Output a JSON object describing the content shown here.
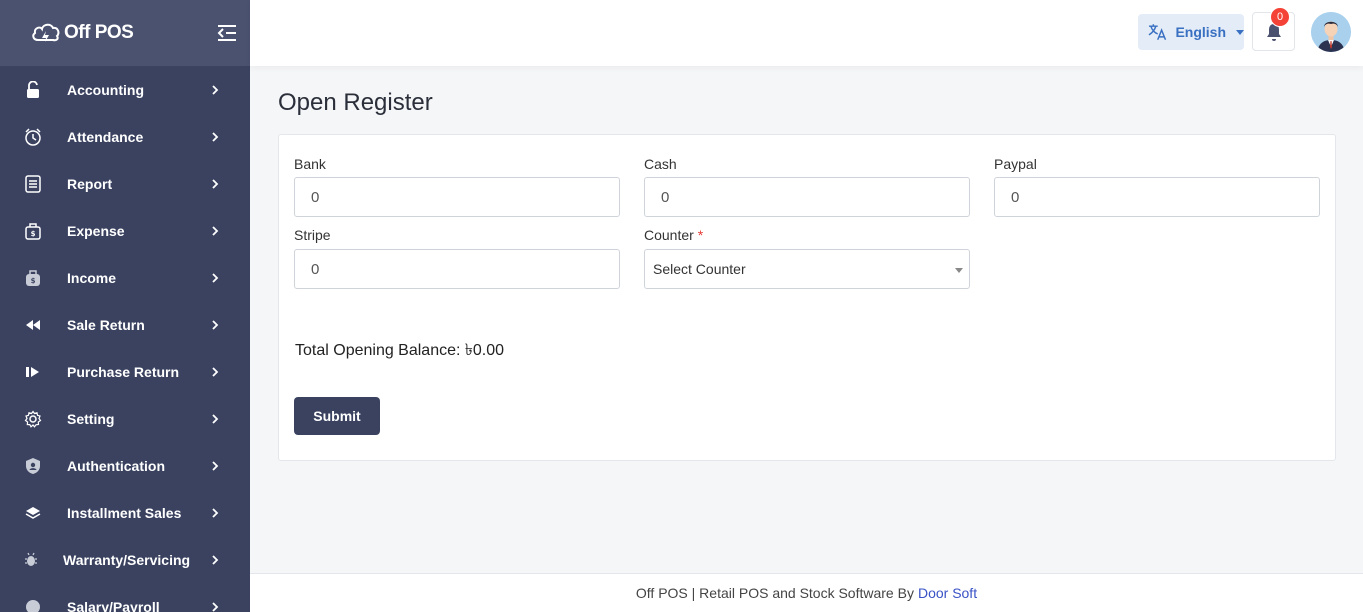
{
  "brand": {
    "name": "Off POS"
  },
  "sidebar": {
    "items": [
      {
        "label": "Accounting",
        "icon": "lock-icon"
      },
      {
        "label": "Attendance",
        "icon": "clock-icon"
      },
      {
        "label": "Report",
        "icon": "report-icon"
      },
      {
        "label": "Expense",
        "icon": "wallet-icon"
      },
      {
        "label": "Income",
        "icon": "money-bag-icon"
      },
      {
        "label": "Sale Return",
        "icon": "rewind-icon"
      },
      {
        "label": "Purchase Return",
        "icon": "forward-icon"
      },
      {
        "label": "Setting",
        "icon": "gear-icon"
      },
      {
        "label": "Authentication",
        "icon": "shield-user-icon"
      },
      {
        "label": "Installment Sales",
        "icon": "layers-icon"
      },
      {
        "label": "Warranty/Servicing",
        "icon": "bug-icon"
      },
      {
        "label": "Salary/Payroll",
        "icon": "coin-icon"
      }
    ]
  },
  "topbar": {
    "language": "English",
    "notification_count": "0"
  },
  "page": {
    "title": "Open Register"
  },
  "form": {
    "bank": {
      "label": "Bank",
      "value": "0"
    },
    "cash": {
      "label": "Cash",
      "value": "0"
    },
    "paypal": {
      "label": "Paypal",
      "value": "0"
    },
    "stripe": {
      "label": "Stripe",
      "value": "0"
    },
    "counter": {
      "label": "Counter",
      "required_mark": "*",
      "selected": "Select Counter"
    },
    "total_label": "Total Opening Balance:",
    "total_value": "৳0.00",
    "submit_label": "Submit"
  },
  "footer": {
    "text": "Off POS | Retail POS and Stock Software By",
    "link": "Door Soft"
  },
  "colors": {
    "sidebar_bg": "#3a4260",
    "accent_blue": "#3a70c2",
    "badge_red": "#f44336"
  }
}
